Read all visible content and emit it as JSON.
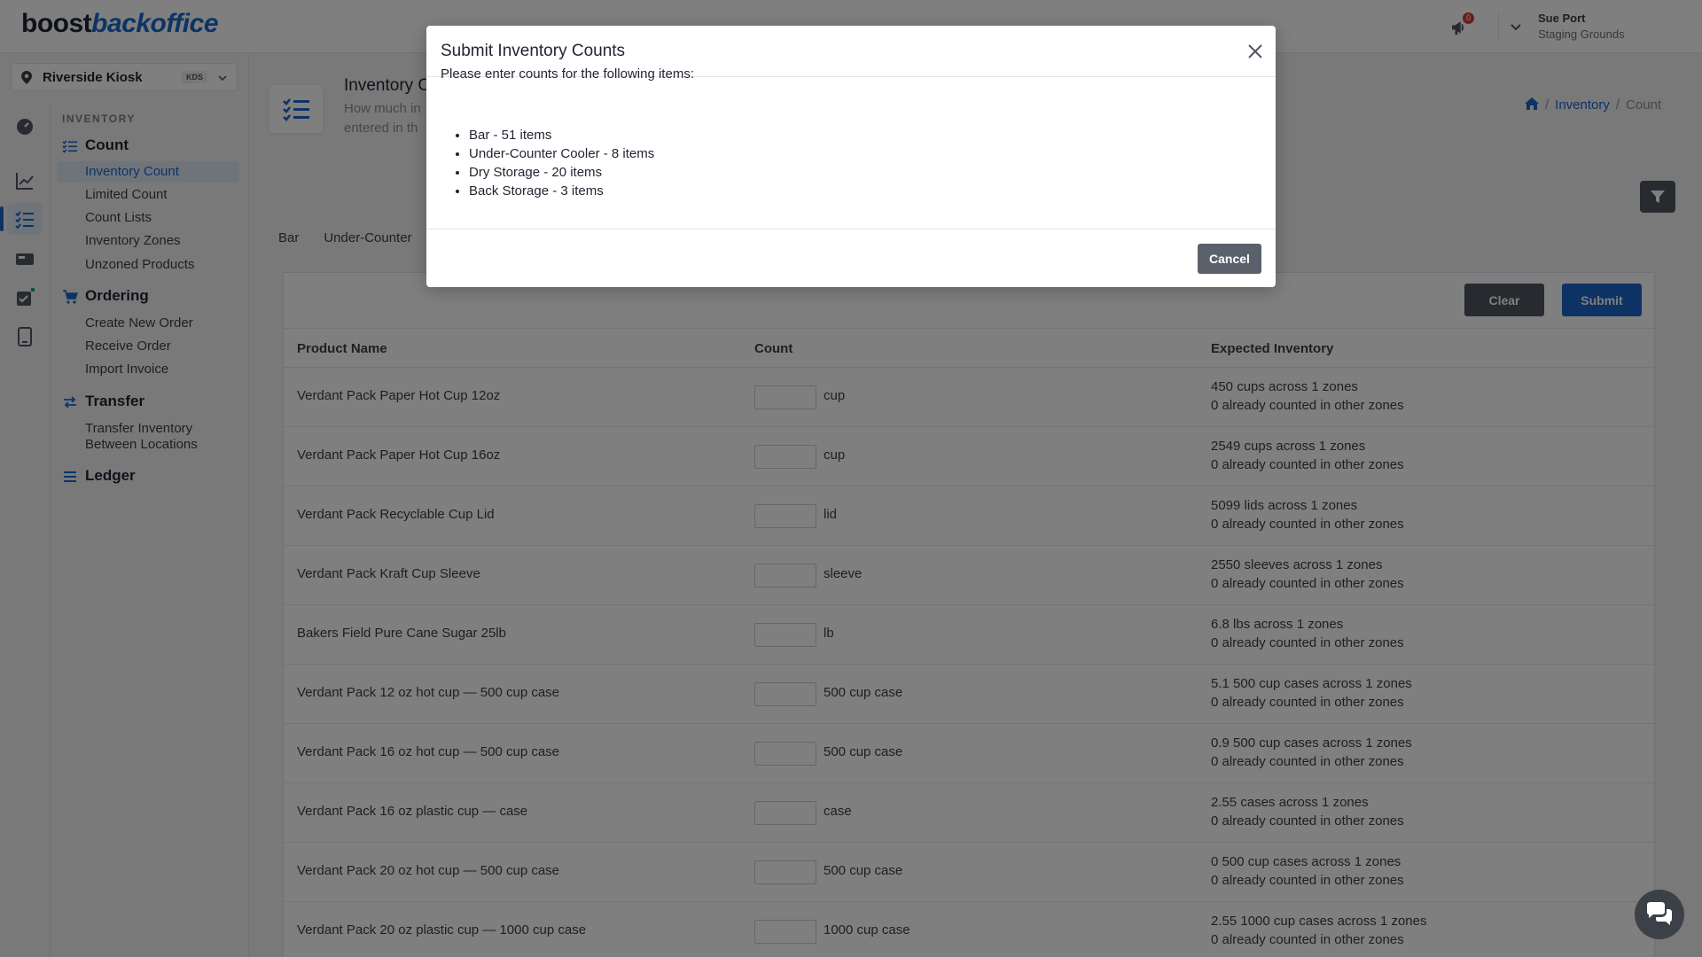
{
  "app": {
    "logo_part1": "boost",
    "logo_part2": "backoffice",
    "notifications_count": "0",
    "user_name": "Sue Port",
    "user_org": "Staging Grounds"
  },
  "location": {
    "name": "Riverside Kiosk",
    "tag": "KDS"
  },
  "sidebar": {
    "section": "INVENTORY",
    "groups": [
      {
        "label": "Count",
        "icon": "list-check-icon",
        "items": [
          "Inventory Count",
          "Limited Count",
          "Count Lists",
          "Inventory Zones",
          "Unzoned Products"
        ]
      },
      {
        "label": "Ordering",
        "icon": "cart-icon",
        "items": [
          "Create New Order",
          "Receive Order",
          "Import Invoice"
        ]
      },
      {
        "label": "Transfer",
        "icon": "transfer-icon",
        "items": [
          "Transfer Inventory Between Locations"
        ]
      },
      {
        "label": "Ledger",
        "icon": "ledger-icon",
        "items": []
      }
    ],
    "active_item": "Inventory Count"
  },
  "page": {
    "title": "Inventory C",
    "subtitle": "How much in entered in th",
    "breadcrumbs": [
      "Inventory",
      "Count"
    ]
  },
  "tabs": [
    "Bar",
    "Under-Counter"
  ],
  "actions": {
    "clear": "Clear",
    "submit": "Submit"
  },
  "table": {
    "headers": [
      "Product Name",
      "Count",
      "Expected Inventory"
    ],
    "rows": [
      {
        "name": "Verdant Pack Paper Hot Cup 12oz",
        "unit": "cup",
        "exp1": "450 cups across 1 zones",
        "exp2": "0 already counted in other zones"
      },
      {
        "name": "Verdant Pack Paper Hot Cup 16oz",
        "unit": "cup",
        "exp1": "2549 cups across 1 zones",
        "exp2": "0 already counted in other zones"
      },
      {
        "name": "Verdant Pack Recyclable Cup Lid",
        "unit": "lid",
        "exp1": "5099 lids across 1 zones",
        "exp2": "0 already counted in other zones"
      },
      {
        "name": "Verdant Pack Kraft Cup Sleeve",
        "unit": "sleeve",
        "exp1": "2550 sleeves across 1 zones",
        "exp2": "0 already counted in other zones"
      },
      {
        "name": "Bakers Field Pure Cane Sugar 25lb",
        "unit": "lb",
        "exp1": "6.8 lbs across 1 zones",
        "exp2": "0 already counted in other zones"
      },
      {
        "name": "Verdant Pack 12 oz hot cup — 500 cup case",
        "unit": "500 cup case",
        "exp1": "5.1 500 cup cases across 1 zones",
        "exp2": "0 already counted in other zones"
      },
      {
        "name": "Verdant Pack 16 oz hot cup — 500 cup case",
        "unit": "500 cup case",
        "exp1": "0.9 500 cup cases across 1 zones",
        "exp2": "0 already counted in other zones"
      },
      {
        "name": "Verdant Pack 16 oz plastic cup — case",
        "unit": "case",
        "exp1": "2.55 cases across 1 zones",
        "exp2": "0 already counted in other zones"
      },
      {
        "name": "Verdant Pack 20 oz hot cup — 500 cup case",
        "unit": "500 cup case",
        "exp1": "0 500 cup cases across 1 zones",
        "exp2": "0 already counted in other zones"
      },
      {
        "name": "Verdant Pack 20 oz plastic cup — 1000 cup case",
        "unit": "1000 cup case",
        "exp1": "2.55 1000 cup cases across 1 zones",
        "exp2": "0 already counted in other zones"
      }
    ]
  },
  "modal": {
    "title": "Submit Inventory Counts",
    "intro": "Please enter counts for the following items:",
    "items": [
      "Bar - 51 items",
      "Under-Counter Cooler - 8 items",
      "Dry Storage - 20 items",
      "Back Storage - 3 items"
    ],
    "cancel": "Cancel"
  },
  "colors": {
    "accent": "#1a66c8",
    "dark_button": "#4f5660",
    "badge": "#d83a3a"
  }
}
